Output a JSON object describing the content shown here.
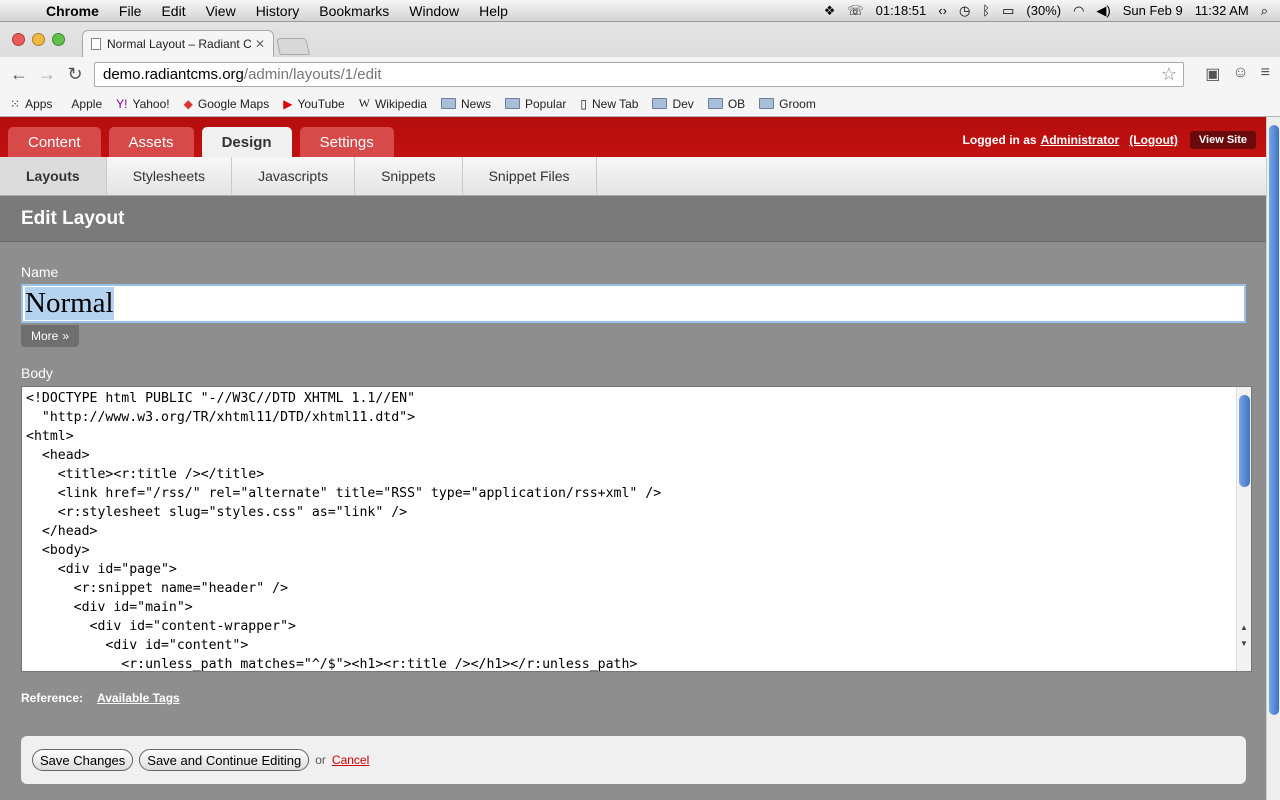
{
  "menubar": {
    "app": "Chrome",
    "items": [
      "File",
      "Edit",
      "View",
      "History",
      "Bookmarks",
      "Window",
      "Help"
    ],
    "timer": "01:18:51",
    "battery": "(30%)",
    "date": "Sun Feb 9",
    "time": "11:32 AM"
  },
  "browser": {
    "tab_title": "Normal Layout – Radiant C",
    "url_host": "demo.radiantcms.org",
    "url_path": "/admin/layouts/1/edit",
    "bookmarks": [
      "Apps",
      "Apple",
      "Yahoo!",
      "Google Maps",
      "YouTube",
      "Wikipedia",
      "News",
      "Popular",
      "New Tab",
      "Dev",
      "OB",
      "Groom"
    ]
  },
  "header": {
    "tabs": [
      "Content",
      "Assets",
      "Design",
      "Settings"
    ],
    "logged_in_prefix": "Logged in as",
    "user": "Administrator",
    "logout": "(Logout)",
    "view_site": "View Site"
  },
  "subnav": [
    "Layouts",
    "Stylesheets",
    "Javascripts",
    "Snippets",
    "Snippet Files"
  ],
  "page": {
    "title": "Edit Layout",
    "name_label": "Name",
    "name_value": "Normal",
    "more_label": "More",
    "body_label": "Body",
    "body_code": "<!DOCTYPE html PUBLIC \"-//W3C//DTD XHTML 1.1//EN\"\n  \"http://www.w3.org/TR/xhtml11/DTD/xhtml11.dtd\">\n<html>\n  <head>\n    <title><r:title /></title>\n    <link href=\"/rss/\" rel=\"alternate\" title=\"RSS\" type=\"application/rss+xml\" />\n    <r:stylesheet slug=\"styles.css\" as=\"link\" />\n  </head>\n  <body>\n    <div id=\"page\">\n      <r:snippet name=\"header\" />\n      <div id=\"main\">\n        <div id=\"content-wrapper\">\n          <div id=\"content\">\n            <r:unless_path matches=\"^/$\"><h1><r:title /></h1></r:unless_path>",
    "reference_label": "Reference:",
    "available_tags": "Available Tags",
    "save_changes": "Save Changes",
    "save_continue": "Save and Continue Editing",
    "or": "or",
    "cancel": "Cancel"
  }
}
